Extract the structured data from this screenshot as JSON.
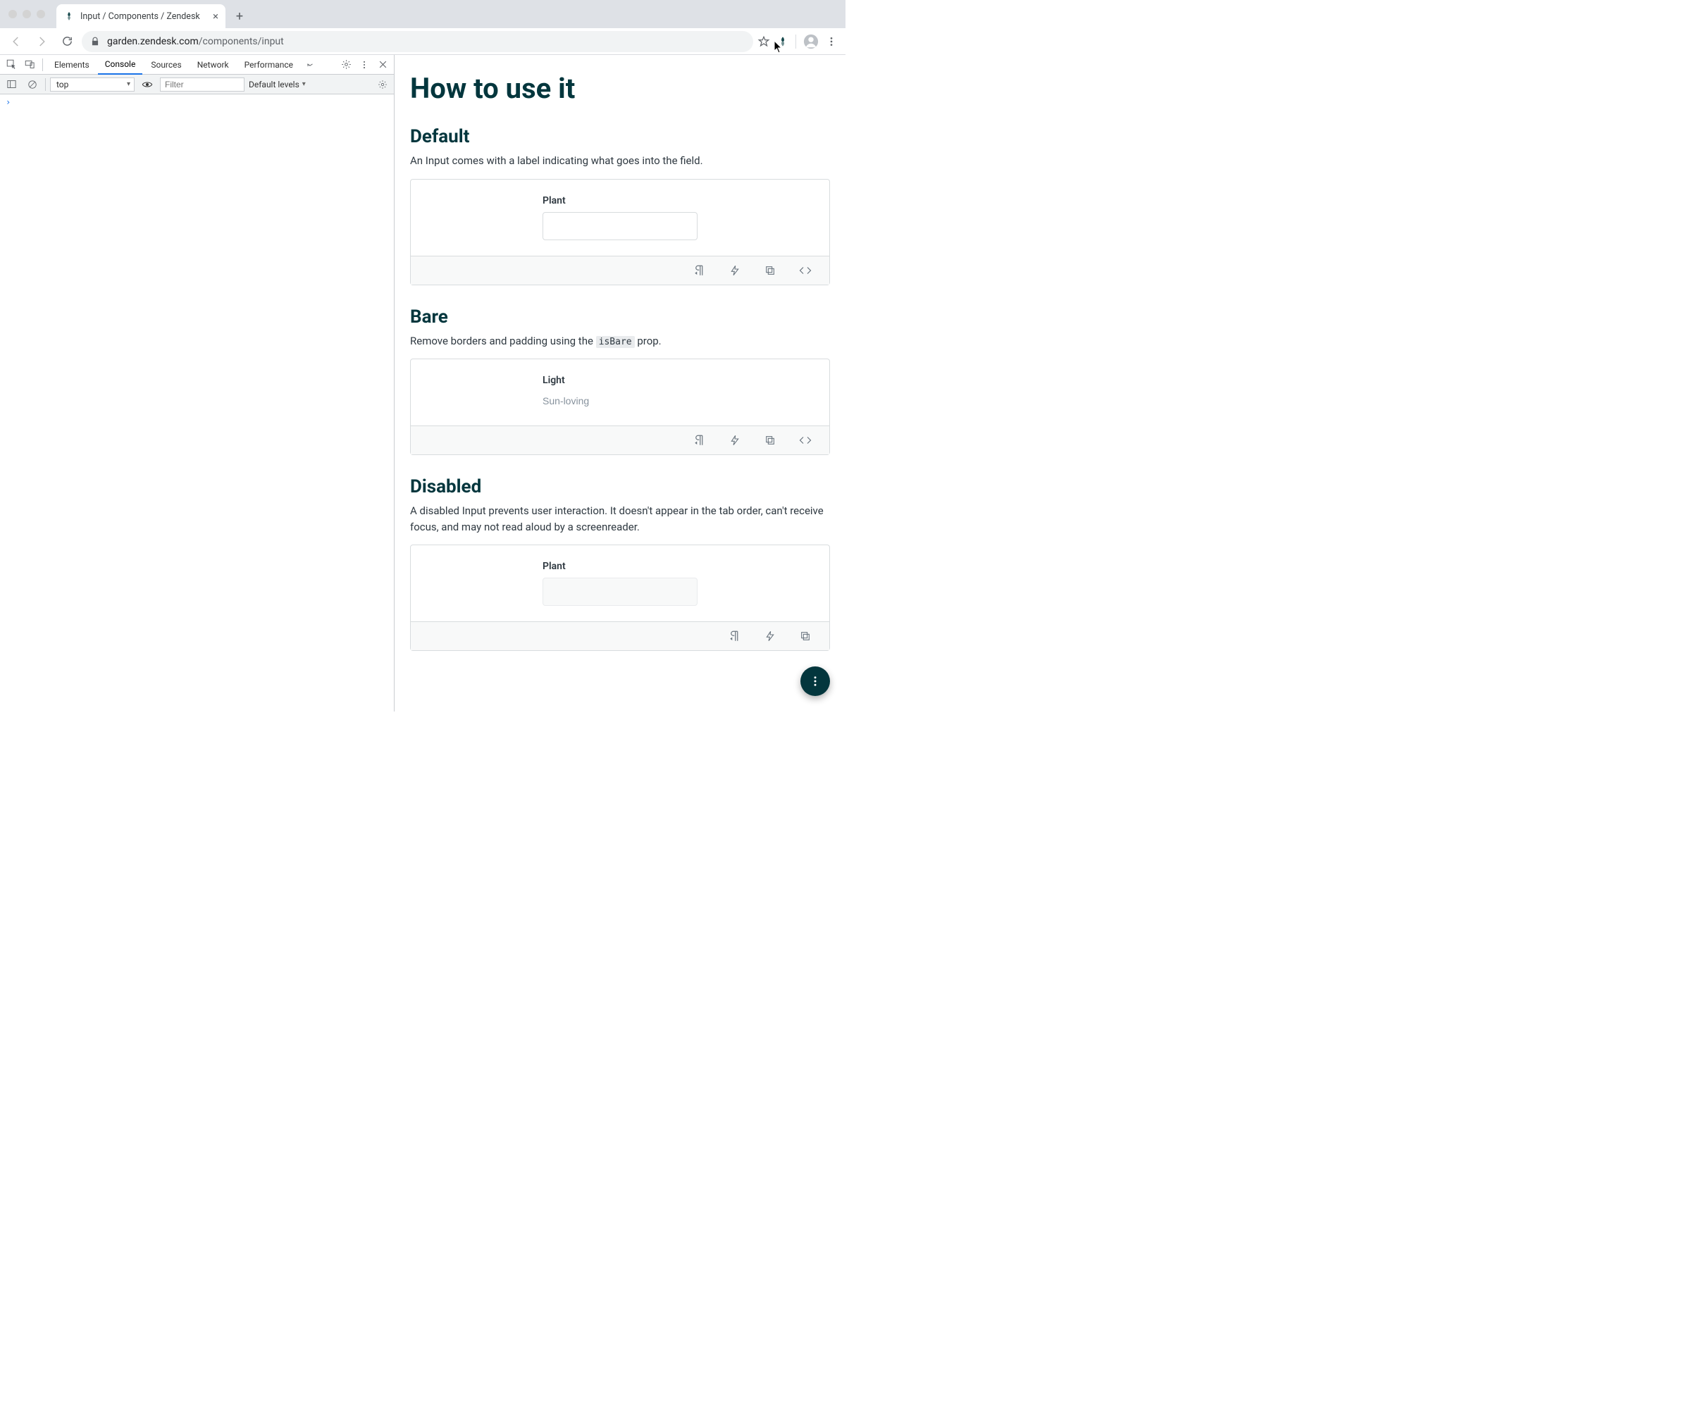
{
  "browser": {
    "tab_title": "Input / Components / Zendesk",
    "url_host": "garden.zendesk.com",
    "url_path": "/components/input"
  },
  "devtools": {
    "tabs": [
      "Elements",
      "Console",
      "Sources",
      "Network",
      "Performance"
    ],
    "active_tab": "Console",
    "context": "top",
    "filter_placeholder": "Filter",
    "levels": "Default levels"
  },
  "page": {
    "title": "How to use it",
    "sections": {
      "default": {
        "heading": "Default",
        "desc": "An Input comes with a label indicating what goes into the field.",
        "label": "Plant"
      },
      "bare": {
        "heading": "Bare",
        "desc_pre": "Remove borders and padding using the ",
        "desc_code": "isBare",
        "desc_post": " prop.",
        "label": "Light",
        "placeholder": "Sun-loving"
      },
      "disabled": {
        "heading": "Disabled",
        "desc": "A disabled Input prevents user interaction. It doesn't appear in the tab order, can't receive focus, and may not read aloud by a screenreader.",
        "label": "Plant"
      }
    }
  }
}
